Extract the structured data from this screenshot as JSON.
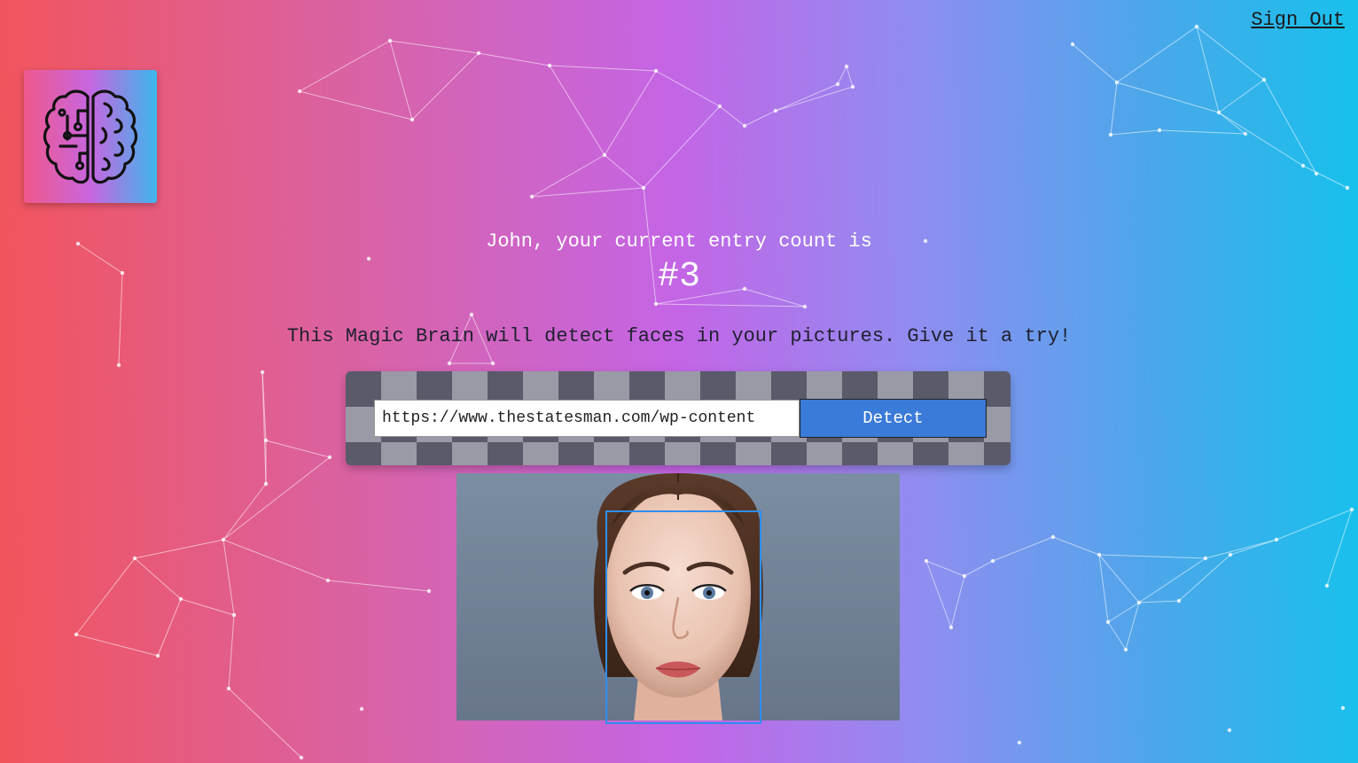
{
  "header": {
    "sign_out_label": "Sign Out"
  },
  "logo": {
    "icon": "brain-icon"
  },
  "rank": {
    "greeting": "John, your current entry count is",
    "count": "#3"
  },
  "intro_text": "This Magic Brain will detect faces in your pictures. Give it a try!",
  "form": {
    "url_value": "https://www.thestatesman.com/wp-content",
    "detect_label": "Detect"
  },
  "colors": {
    "gradient_left": "#f2545b",
    "gradient_mid": "#c465e6",
    "gradient_right": "#17c1ec",
    "detect_button": "#3a7ad8",
    "face_box": "#2f8ef0"
  }
}
